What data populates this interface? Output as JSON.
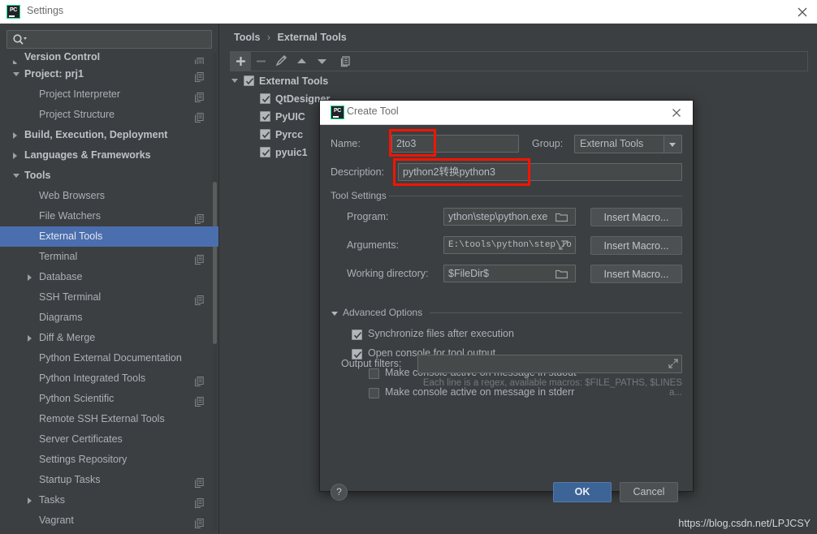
{
  "window": {
    "title": "Settings",
    "logo_text": "PC",
    "close_icon": "close-icon"
  },
  "search": {
    "value": "",
    "placeholder": "",
    "icon": "search-icon"
  },
  "sidebar": {
    "items": [
      {
        "label": "Version Control",
        "depth": 1,
        "bold": true,
        "arrow": "right",
        "copy": true,
        "clipped": true
      },
      {
        "label": "Project: prj1",
        "depth": 1,
        "bold": true,
        "arrow": "down",
        "copy": true
      },
      {
        "label": "Project Interpreter",
        "depth": 2,
        "bold": false,
        "arrow": "",
        "copy": true
      },
      {
        "label": "Project Structure",
        "depth": 2,
        "bold": false,
        "arrow": "",
        "copy": true
      },
      {
        "label": "Build, Execution, Deployment",
        "depth": 1,
        "bold": true,
        "arrow": "right",
        "copy": false
      },
      {
        "label": "Languages & Frameworks",
        "depth": 1,
        "bold": true,
        "arrow": "right",
        "copy": false
      },
      {
        "label": "Tools",
        "depth": 1,
        "bold": true,
        "arrow": "down",
        "copy": false
      },
      {
        "label": "Web Browsers",
        "depth": 2,
        "bold": false,
        "arrow": "",
        "copy": false
      },
      {
        "label": "File Watchers",
        "depth": 2,
        "bold": false,
        "arrow": "",
        "copy": true
      },
      {
        "label": "External Tools",
        "depth": 2,
        "bold": false,
        "arrow": "",
        "copy": false,
        "selected": true
      },
      {
        "label": "Terminal",
        "depth": 2,
        "bold": false,
        "arrow": "",
        "copy": true
      },
      {
        "label": "Database",
        "depth": 2,
        "bold": false,
        "arrow": "right",
        "copy": false
      },
      {
        "label": "SSH Terminal",
        "depth": 2,
        "bold": false,
        "arrow": "",
        "copy": true
      },
      {
        "label": "Diagrams",
        "depth": 2,
        "bold": false,
        "arrow": "",
        "copy": false
      },
      {
        "label": "Diff & Merge",
        "depth": 2,
        "bold": false,
        "arrow": "right",
        "copy": false
      },
      {
        "label": "Python External Documentation",
        "depth": 2,
        "bold": false,
        "arrow": "",
        "copy": false
      },
      {
        "label": "Python Integrated Tools",
        "depth": 2,
        "bold": false,
        "arrow": "",
        "copy": true
      },
      {
        "label": "Python Scientific",
        "depth": 2,
        "bold": false,
        "arrow": "",
        "copy": true
      },
      {
        "label": "Remote SSH External Tools",
        "depth": 2,
        "bold": false,
        "arrow": "",
        "copy": false
      },
      {
        "label": "Server Certificates",
        "depth": 2,
        "bold": false,
        "arrow": "",
        "copy": false
      },
      {
        "label": "Settings Repository",
        "depth": 2,
        "bold": false,
        "arrow": "",
        "copy": false
      },
      {
        "label": "Startup Tasks",
        "depth": 2,
        "bold": false,
        "arrow": "",
        "copy": true
      },
      {
        "label": "Tasks",
        "depth": 2,
        "bold": false,
        "arrow": "right",
        "copy": true
      },
      {
        "label": "Vagrant",
        "depth": 2,
        "bold": false,
        "arrow": "",
        "copy": true
      }
    ]
  },
  "content": {
    "breadcrumb": {
      "parent": "Tools",
      "separator": "›",
      "current": "External Tools"
    },
    "toolbar": [
      {
        "name": "add-button",
        "icon": "plus-icon",
        "active": true
      },
      {
        "name": "remove-button",
        "icon": "minus-icon",
        "active": false
      },
      {
        "name": "edit-button",
        "icon": "pencil-icon",
        "active": false
      },
      {
        "name": "move-up-button",
        "icon": "arrow-up-icon",
        "active": false
      },
      {
        "name": "move-down-button",
        "icon": "arrow-down-icon",
        "active": false
      },
      {
        "name": "copy-button",
        "icon": "copy-icon",
        "active": false
      }
    ],
    "tools_tree": [
      {
        "label": "External Tools",
        "depth": 0,
        "checked": true,
        "expanded": true
      },
      {
        "label": "QtDesigner",
        "depth": 1,
        "checked": true
      },
      {
        "label": "PyUIC",
        "depth": 1,
        "checked": true
      },
      {
        "label": "Pyrcc",
        "depth": 1,
        "checked": true
      },
      {
        "label": "pyuic1",
        "depth": 1,
        "checked": true
      }
    ]
  },
  "dialog": {
    "title": "Create Tool",
    "logo_text": "PC",
    "name_label": "Name:",
    "name_value": "2to3",
    "group_label": "Group:",
    "group_value": "External Tools",
    "description_label": "Description:",
    "description_value": "python2转换python3",
    "tool_settings": {
      "section_title": "Tool Settings",
      "program_label": "Program:",
      "program_value": "ython\\step\\python.exe",
      "arguments_label": "Arguments:",
      "arguments_value": "E:\\tools\\python\\step\\To",
      "working_dir_label": "Working directory:",
      "working_dir_value": "$FileDir$",
      "insert_macro_label": "Insert Macro..."
    },
    "advanced": {
      "section_title": "Advanced Options",
      "options": [
        {
          "label": "Synchronize files after execution",
          "checked": true,
          "indent": 0
        },
        {
          "label": "Open console for tool output",
          "checked": true,
          "indent": 0
        },
        {
          "label": "Make console active on message in stdout",
          "checked": false,
          "indent": 1
        },
        {
          "label": "Make console active on message in stderr",
          "checked": false,
          "indent": 1
        }
      ],
      "output_filters_label": "Output filters:",
      "output_filters_value": "",
      "output_filters_hint": "Each line is a regex, available macros: $FILE_PATHS, $LINES a..."
    },
    "help_label": "?",
    "ok_label": "OK",
    "cancel_label": "Cancel",
    "close_icon": "close-icon"
  },
  "watermark": "https://blog.csdn.net/LPJCSY",
  "colors": {
    "panel_bg": "#3c3f41",
    "selection_blue": "#4b6eaf",
    "ok_button_blue": "#3c6497",
    "annotation_red": "#f51400",
    "titlebar_white": "#ffffff",
    "logo_green": "#21d789"
  }
}
